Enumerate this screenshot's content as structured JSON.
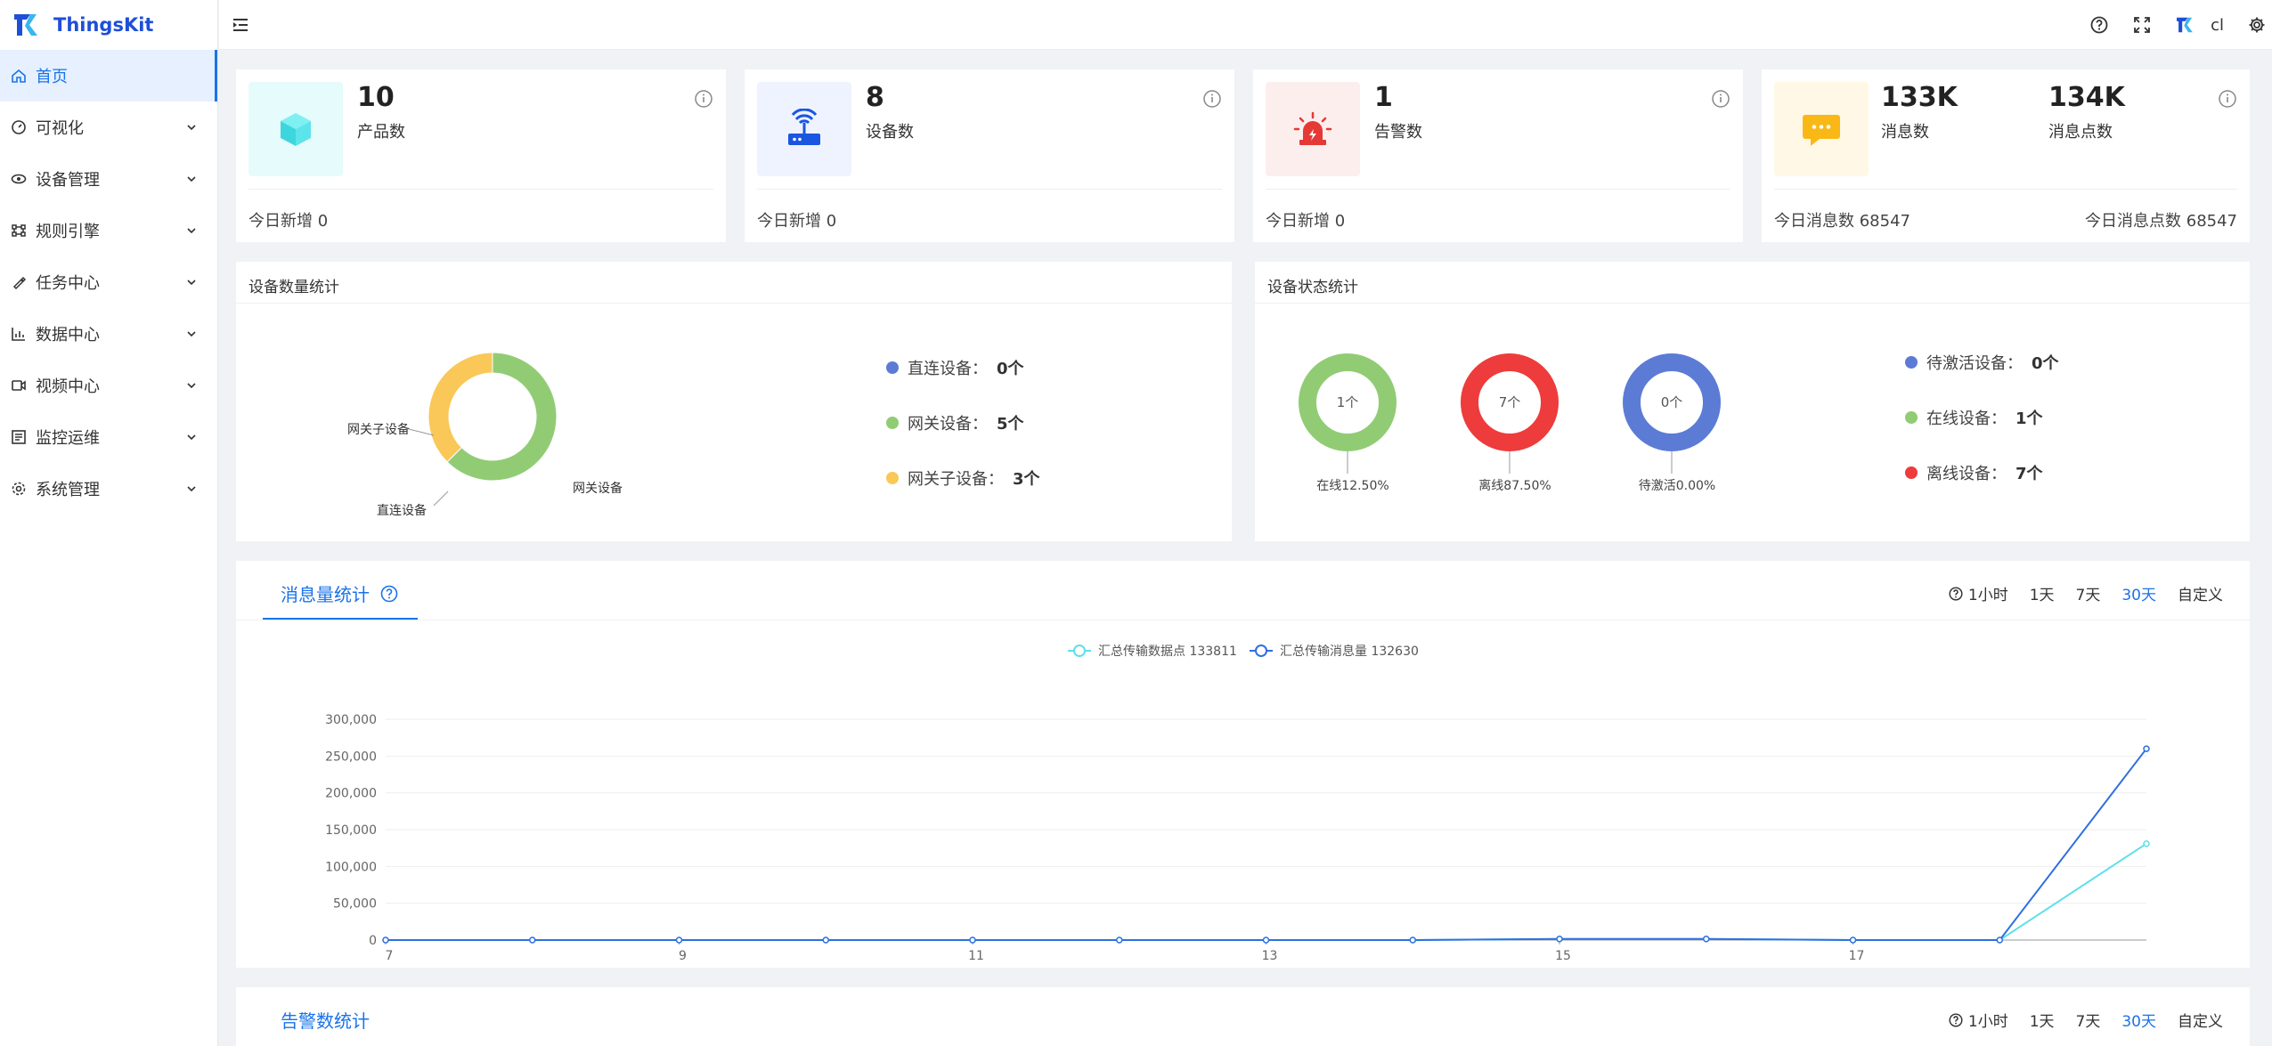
{
  "app": {
    "name": "ThingsKit"
  },
  "sidebar": {
    "items": [
      {
        "label": "首页",
        "icon": "home-icon",
        "active": true
      },
      {
        "label": "可视化",
        "icon": "dashboard-icon"
      },
      {
        "label": "设备管理",
        "icon": "device-icon"
      },
      {
        "label": "规则引擎",
        "icon": "rule-icon"
      },
      {
        "label": "任务中心",
        "icon": "task-icon"
      },
      {
        "label": "数据中心",
        "icon": "data-icon"
      },
      {
        "label": "视频中心",
        "icon": "video-icon"
      },
      {
        "label": "监控运维",
        "icon": "monitor-icon"
      },
      {
        "label": "系统管理",
        "icon": "settings-icon"
      }
    ]
  },
  "header": {
    "user": "cl"
  },
  "stats": {
    "products": {
      "value": "10",
      "label": "产品数",
      "foot": "今日新增 0",
      "color": "#e6fbfc"
    },
    "devices": {
      "value": "8",
      "label": "设备数",
      "foot": "今日新增 0",
      "color": "#eef3ff"
    },
    "alarms": {
      "value": "1",
      "label": "告警数",
      "foot": "今日新增 0",
      "color": "#fdeeee"
    },
    "messages": {
      "value": "133K",
      "label": "消息数",
      "value2": "134K",
      "label2": "消息点数",
      "foot": "今日消息数 68547",
      "foot2": "今日消息点数 68547",
      "color": "#fff8e6"
    }
  },
  "device_count": {
    "title": "设备数量统计",
    "labels": {
      "gateway_sub": "网关子设备",
      "direct": "直连设备",
      "gateway": "网关设备"
    },
    "legend": [
      {
        "label": "直连设备：",
        "value": "0个",
        "color": "#5b7bd5"
      },
      {
        "label": "网关设备：",
        "value": "5个",
        "color": "#91cc75"
      },
      {
        "label": "网关子设备：",
        "value": "3个",
        "color": "#fac858"
      }
    ]
  },
  "device_status": {
    "title": "设备状态统计",
    "rings": [
      {
        "center": "1个",
        "label": "在线12.50%",
        "color": "#91cc75"
      },
      {
        "center": "7个",
        "label": "离线87.50%",
        "color": "#ee3b3b"
      },
      {
        "center": "0个",
        "label": "待激活0.00%",
        "color": "#5b7bd5"
      }
    ],
    "legend": [
      {
        "label": "待激活设备：",
        "value": "0个",
        "color": "#5b7bd5"
      },
      {
        "label": "在线设备：",
        "value": "1个",
        "color": "#91cc75"
      },
      {
        "label": "离线设备：",
        "value": "7个",
        "color": "#ee3b3b"
      }
    ]
  },
  "message_chart": {
    "tab": "消息量统计",
    "ranges": [
      "1小时",
      "1天",
      "7天",
      "30天",
      "自定义"
    ],
    "selected_range": "30天"
  },
  "alarm_chart": {
    "tab": "告警数统计",
    "ranges": [
      "1小时",
      "1天",
      "7天",
      "30天",
      "自定义"
    ],
    "selected_range": "30天"
  },
  "chart_data": [
    {
      "type": "pie",
      "title": "设备数量统计",
      "categories": [
        "直连设备",
        "网关设备",
        "网关子设备"
      ],
      "values": [
        0,
        5,
        3
      ],
      "colors": [
        "#5b7bd5",
        "#91cc75",
        "#fac858"
      ]
    },
    {
      "type": "line",
      "x": [
        7,
        8,
        9,
        10,
        11,
        12,
        13,
        14,
        15,
        16,
        17,
        18,
        19
      ],
      "x_ticks": [
        "7",
        "9",
        "11",
        "13",
        "15",
        "17"
      ],
      "y_ticks": [
        "0",
        "50,000",
        "100,000",
        "150,000",
        "200,000",
        "250,000",
        "300,000"
      ],
      "ylim": [
        0,
        300000
      ],
      "series": [
        {
          "name": "汇总传输数据点 133811",
          "color": "#5ee0e8",
          "values": [
            0,
            0,
            0,
            0,
            0,
            0,
            0,
            0,
            1500,
            1500,
            0,
            0,
            131000
          ]
        },
        {
          "name": "汇总传输消息量 132630",
          "color": "#2f6fe0",
          "values": [
            0,
            0,
            0,
            0,
            0,
            0,
            0,
            0,
            1500,
            1500,
            0,
            0,
            260000
          ]
        }
      ]
    }
  ]
}
